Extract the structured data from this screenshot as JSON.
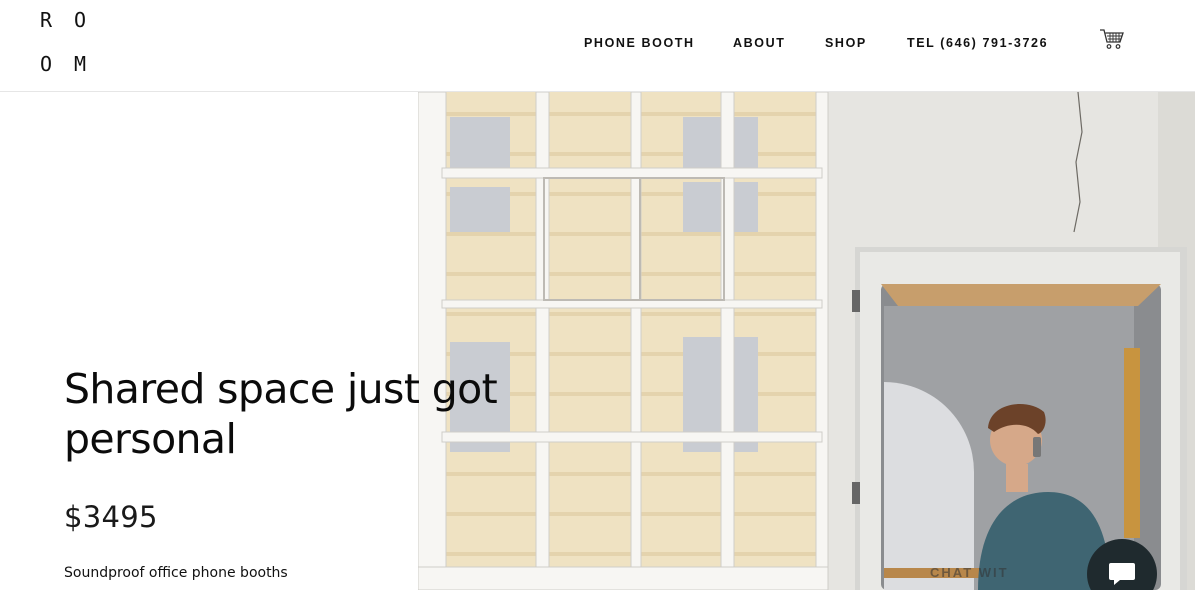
{
  "logo": {
    "letters": [
      "R",
      "O",
      "O",
      "M"
    ]
  },
  "nav": {
    "items": [
      {
        "label": "PHONE BOOTH"
      },
      {
        "label": "ABOUT"
      },
      {
        "label": "SHOP"
      },
      {
        "label": "TEL (646) 791-3726"
      }
    ],
    "cart_icon": "shopping-cart-icon"
  },
  "hero": {
    "headline_line1": "Shared space just got",
    "headline_line2": "personal",
    "price": "$3495",
    "subtitle": "Soundproof office phone booths",
    "image_desc_icon": "phone-booth-photo"
  },
  "chat": {
    "label": "CHAT WIT",
    "icon": "chat-bubble-icon"
  },
  "colors": {
    "text": "#111111",
    "chat_button": "#1f2a2e",
    "background": "#ffffff"
  }
}
